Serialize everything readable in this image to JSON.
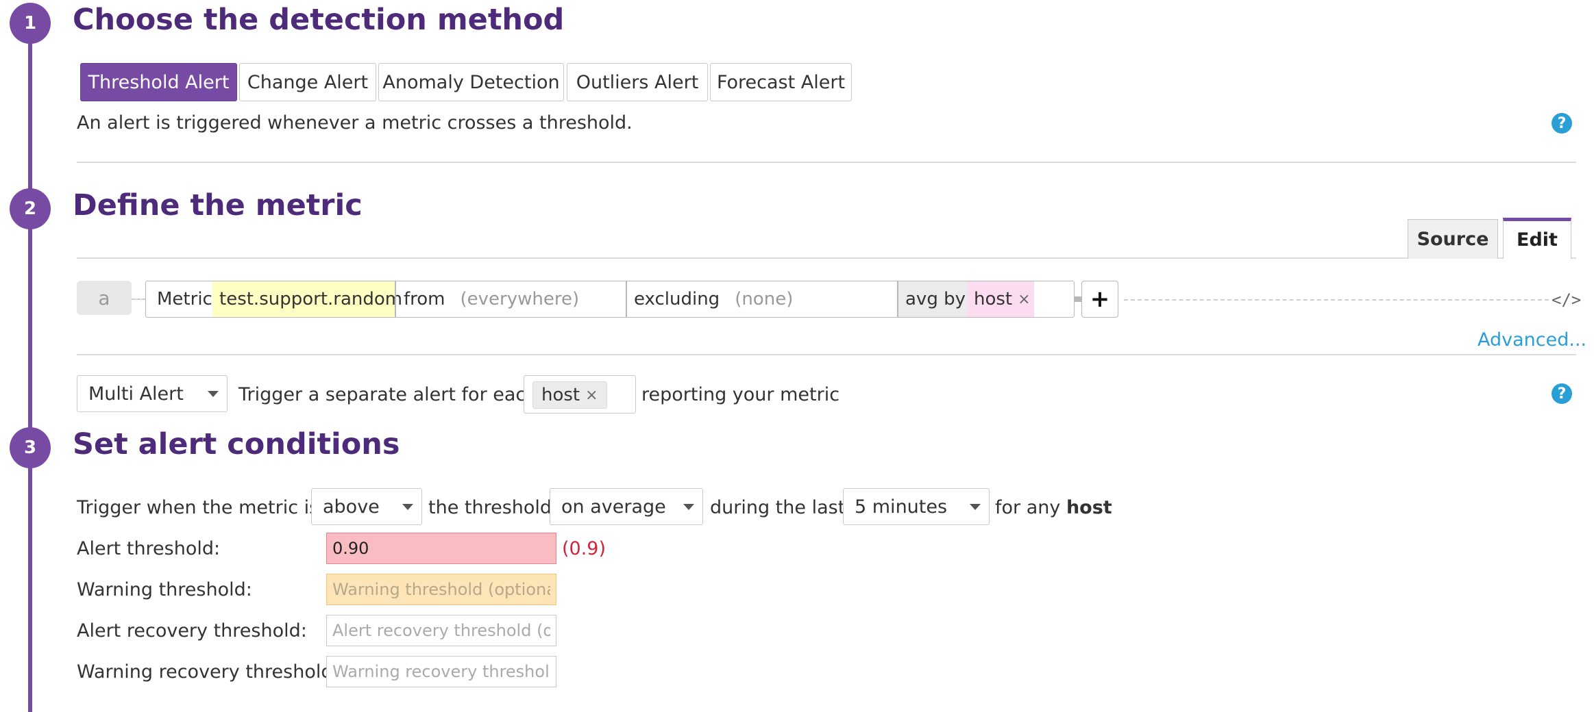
{
  "steps": [
    {
      "number": "1",
      "title": "Choose the detection method"
    },
    {
      "number": "2",
      "title": "Define the metric"
    },
    {
      "number": "3",
      "title": "Set alert conditions"
    }
  ],
  "detection": {
    "tabs": [
      "Threshold Alert",
      "Change Alert",
      "Anomaly Detection",
      "Outliers Alert",
      "Forecast Alert"
    ],
    "active_tab": "Threshold Alert",
    "description": "An alert is triggered whenever a metric crosses a threshold."
  },
  "help_icon_glyph": "?",
  "metric": {
    "view_tabs": {
      "source": "Source",
      "edit": "Edit",
      "active": "Edit"
    },
    "query_label": "a",
    "metric_label": "Metric",
    "metric_value": "test.support.random",
    "from_label": "from",
    "from_value": "(everywhere)",
    "excluding_label": "excluding",
    "excluding_value": "(none)",
    "avg_by_label": "avg by",
    "avg_by_value": "host",
    "remove_glyph": "×",
    "add_glyph": "+",
    "code_glyph": "</>",
    "advanced_link": "Advanced..."
  },
  "multi_alert": {
    "mode": "Multi Alert",
    "prefix": "Trigger a separate alert for each",
    "tag": "host",
    "suffix": "reporting your metric"
  },
  "conditions": {
    "trigger_prefix": "Trigger when the metric is",
    "comparator": "above",
    "threshold_text": "the threshold",
    "aggregation": "on average",
    "during_text": "during the last",
    "window": "5 minutes",
    "for_any_text": "for any",
    "group": "host",
    "alert_threshold_label": "Alert threshold:",
    "alert_threshold_value": "0.90",
    "alert_threshold_parsed": "(0.9)",
    "warning_threshold_label": "Warning threshold:",
    "warning_threshold_placeholder": "Warning threshold (optional)",
    "alert_recovery_label": "Alert recovery threshold:",
    "alert_recovery_placeholder": "Alert recovery threshold (optional)",
    "warning_recovery_label": "Warning recovery threshold:",
    "warning_recovery_placeholder": "Warning recovery threshold (optional)"
  },
  "colors": {
    "brand_purple": "#774aa4",
    "title_purple": "#4d2a7a",
    "link_blue": "#2a9fd6",
    "alert_red": "#f8bcc2",
    "warning_orange": "#fde5b8",
    "metric_highlight": "#ffffc4",
    "group_highlight": "#fbdcf0"
  }
}
